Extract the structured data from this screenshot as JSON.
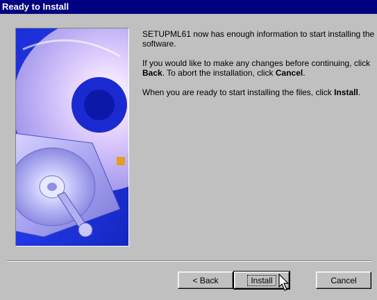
{
  "window": {
    "title": "Ready to Install"
  },
  "illustration": {
    "name": "cd-and-harddisk-graphic"
  },
  "content": {
    "para1": "SETUPML61 now has enough information to start installing the software.",
    "para2_a": "If you would like to make any changes before continuing, click ",
    "para2_back": "Back",
    "para2_b": ". To abort the installation, click ",
    "para2_cancel": "Cancel",
    "para2_c": ".",
    "para3_a": "When you are ready to start installing the files, click ",
    "para3_install": "Install",
    "para3_b": "."
  },
  "buttons": {
    "back": "< Back",
    "install": "Install",
    "cancel": "Cancel"
  },
  "colors": {
    "titlebar": "#000080",
    "dialog_bg": "#c0c0c0"
  }
}
